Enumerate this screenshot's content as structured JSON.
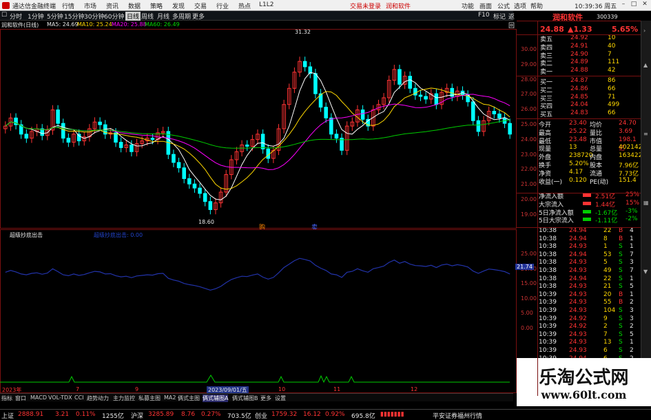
{
  "app": {
    "title": "通达信金融终端",
    "menu": [
      "行情",
      "市场",
      "资讯",
      "数据",
      "策略",
      "发现",
      "交易",
      "行业",
      "热点",
      "L1L2"
    ],
    "alerts": [
      "交易未登录",
      "润和软件"
    ],
    "right_menu": [
      "功能",
      "画面",
      "公式",
      "选项",
      "帮助"
    ],
    "time": "10:39:36 周五"
  },
  "toolbar": {
    "items": [
      "分时",
      "1分钟",
      "5分钟",
      "15分钟",
      "30分钟",
      "60分钟",
      "日线",
      "周线",
      "月线",
      "多周期",
      "更多"
    ],
    "active": "日线",
    "right": [
      "F10",
      "标记",
      "返回"
    ]
  },
  "chart_header": {
    "stock": "润和软件(日线)",
    "ma5": "MA5: 24.69",
    "ma10": "MA10: 25.24",
    "ma20": "MA20: 25.88",
    "ma60": "MA60: 26.49"
  },
  "price_axis": [
    "30.00",
    "29.00",
    "28.00",
    "27.00",
    "26.00",
    "25.00",
    "24.00",
    "23.00",
    "22.00",
    "21.00",
    "20.00",
    "19.00"
  ],
  "chart_marks": {
    "high": "31.32",
    "low": "18.60",
    "m1": "购",
    "m2": "卖"
  },
  "chart_data": {
    "type": "candlestick",
    "ylim": [
      18,
      32
    ],
    "close": [
      25.2,
      25.8,
      25.3,
      24.6,
      24.3,
      24.8,
      25.0,
      24.5,
      24.9,
      26.4,
      25.4,
      24.3,
      24.0,
      24.6,
      24.1,
      24.4,
      25.0,
      25.5,
      25.3,
      24.6,
      24.7,
      24.0,
      23.6,
      23.8,
      23.3,
      23.9,
      24.1,
      24.3,
      24.2,
      24.7,
      24.8,
      23.1,
      22.5,
      22.1,
      21.3,
      20.9,
      20.6,
      20.2,
      19.6,
      19.0,
      19.5,
      20.3,
      21.6,
      22.7,
      23.3,
      23.8,
      23.7,
      24.2,
      24.6,
      23.5,
      22.8,
      23.4,
      25.0,
      26.8,
      28.0,
      29.2,
      30.0,
      29.6,
      29.1,
      27.6,
      26.6,
      25.8,
      24.6,
      24.3,
      23.4,
      25.2,
      25.5,
      26.4,
      25.7,
      25.2,
      26.4,
      26.8,
      27.3,
      28.6,
      29.4,
      28.3,
      28.9,
      28.0,
      27.5,
      27.4,
      27.2,
      27.6,
      26.8,
      27.7,
      28.0,
      27.4,
      27.8,
      27.5,
      27.0,
      25.6,
      24.8,
      25.6,
      26.3,
      26.1,
      25.8,
      25.4,
      24.6
    ]
  },
  "indicator": {
    "name": "超级抄底出击",
    "value_text": "超级抄底出击: 0.00",
    "axis": [
      "25.00",
      "20.00",
      "15.00",
      "10.00",
      "5.00",
      "0.00"
    ],
    "current": "21.74"
  },
  "bottom_dates": {
    "d1": "2023年",
    "d2": "2023/09/01/五",
    "ticks": [
      "7",
      "9",
      "10",
      "11",
      "12"
    ]
  },
  "bottom_tabs": [
    "指标",
    "窗口",
    "MACD",
    "VOL-TDX",
    "CCI",
    "趋势动力",
    "主力监控",
    "私募主图",
    "MA2",
    "俩式主图",
    "俩式辅图A",
    "俩式辅图B",
    "更多",
    "设置"
  ],
  "active_tab": "俩式辅图A",
  "quote": {
    "name": "润和软件",
    "code": "300339",
    "price": "24.88",
    "change": "1.33",
    "pct": "5.65%",
    "asks": [
      [
        "卖五",
        "24.92",
        "10"
      ],
      [
        "卖四",
        "24.91",
        "40"
      ],
      [
        "卖三",
        "24.90",
        "7"
      ],
      [
        "卖二",
        "24.89",
        "111"
      ],
      [
        "卖一",
        "24.88",
        "42"
      ]
    ],
    "bids": [
      [
        "买一",
        "24.87",
        "86"
      ],
      [
        "买二",
        "24.86",
        "66"
      ],
      [
        "买三",
        "24.85",
        "71"
      ],
      [
        "买四",
        "24.04",
        "499"
      ],
      [
        "买五",
        "24.83",
        "66"
      ]
    ],
    "stats": [
      [
        "今开",
        "23.40",
        "均价",
        "24.70"
      ],
      [
        "最高",
        "25.22",
        "量比",
        "3.69"
      ],
      [
        "最低",
        "23.48",
        "市值",
        "198.1亿"
      ],
      [
        "现量",
        "13",
        "总量",
        "402142"
      ],
      [
        "外盘",
        "238720",
        "内盘",
        "163422"
      ],
      [
        "换手",
        "5.20%",
        "股本",
        "7.96亿"
      ],
      [
        "净资",
        "4.17",
        "流通",
        "7.73亿"
      ],
      [
        "收益(一)",
        "0.120",
        "PE(动)",
        "151.4"
      ]
    ],
    "flows": [
      [
        "净流入额",
        "2.51亿",
        "25%"
      ],
      [
        "大宗流入",
        "1.44亿",
        "15%"
      ],
      [
        "5日净流入额",
        "-1.67亿",
        "-3%"
      ],
      [
        "5日大宗流入",
        "-1.11亿",
        "-2%"
      ]
    ],
    "ticks": [
      [
        "10:38",
        "24.94",
        "22",
        "B",
        "4"
      ],
      [
        "10:38",
        "24.94",
        "8",
        "B",
        "1"
      ],
      [
        "10:38",
        "24.93",
        "1",
        "S",
        "1"
      ],
      [
        "10:38",
        "24.94",
        "53",
        "S",
        "7"
      ],
      [
        "10:38",
        "24.93",
        "5",
        "S",
        "3"
      ],
      [
        "10:38",
        "24.93",
        "49",
        "S",
        "7"
      ],
      [
        "10:38",
        "24.94",
        "22",
        "S",
        "1"
      ],
      [
        "10:38",
        "24.93",
        "21",
        "S",
        "5"
      ],
      [
        "10:39",
        "24.93",
        "20",
        "B",
        "1"
      ],
      [
        "10:39",
        "24.93",
        "55",
        "B",
        "2"
      ],
      [
        "10:39",
        "24.93",
        "104",
        "S",
        "3"
      ],
      [
        "10:39",
        "24.92",
        "9",
        "S",
        "3"
      ],
      [
        "10:39",
        "24.92",
        "2",
        "S",
        "2"
      ],
      [
        "10:39",
        "24.93",
        "7",
        "S",
        "5"
      ],
      [
        "10:39",
        "24.93",
        "13",
        "S",
        "1"
      ],
      [
        "10:39",
        "24.93",
        "6",
        "S",
        "2"
      ],
      [
        "10:39",
        "24.94",
        "6",
        "S",
        "2"
      ],
      [
        "10:39",
        "24.94",
        "2",
        "S",
        "5"
      ]
    ]
  },
  "status": {
    "sh_label": "上证",
    "sh_val": "2888.91",
    "sh_chg": "3.21",
    "sh_pct": "0.11%",
    "sh_amt": "1255亿",
    "sz_label": "沪深",
    "sz_val": "3285.89",
    "sz_chg": "8.76",
    "sz_pct": "0.27%",
    "sz_amt": "703.5亿",
    "cy_label": "创业",
    "cy_val": "1759.32",
    "cy_chg": "16.12",
    "cy_pct": "0.92%",
    "cy_amt": "695.8亿",
    "broker": "平安证券福州行情"
  },
  "watermark": {
    "line1": "乐淘公式网",
    "line2": "www.60lt.com"
  },
  "colors": {
    "up": "#ff3333",
    "down": "#00ffff",
    "ma5": "#ffffff",
    "ma10": "#ffd800",
    "ma20": "#ff00ff",
    "ma60": "#00cc00",
    "ind": "#2233aa"
  }
}
